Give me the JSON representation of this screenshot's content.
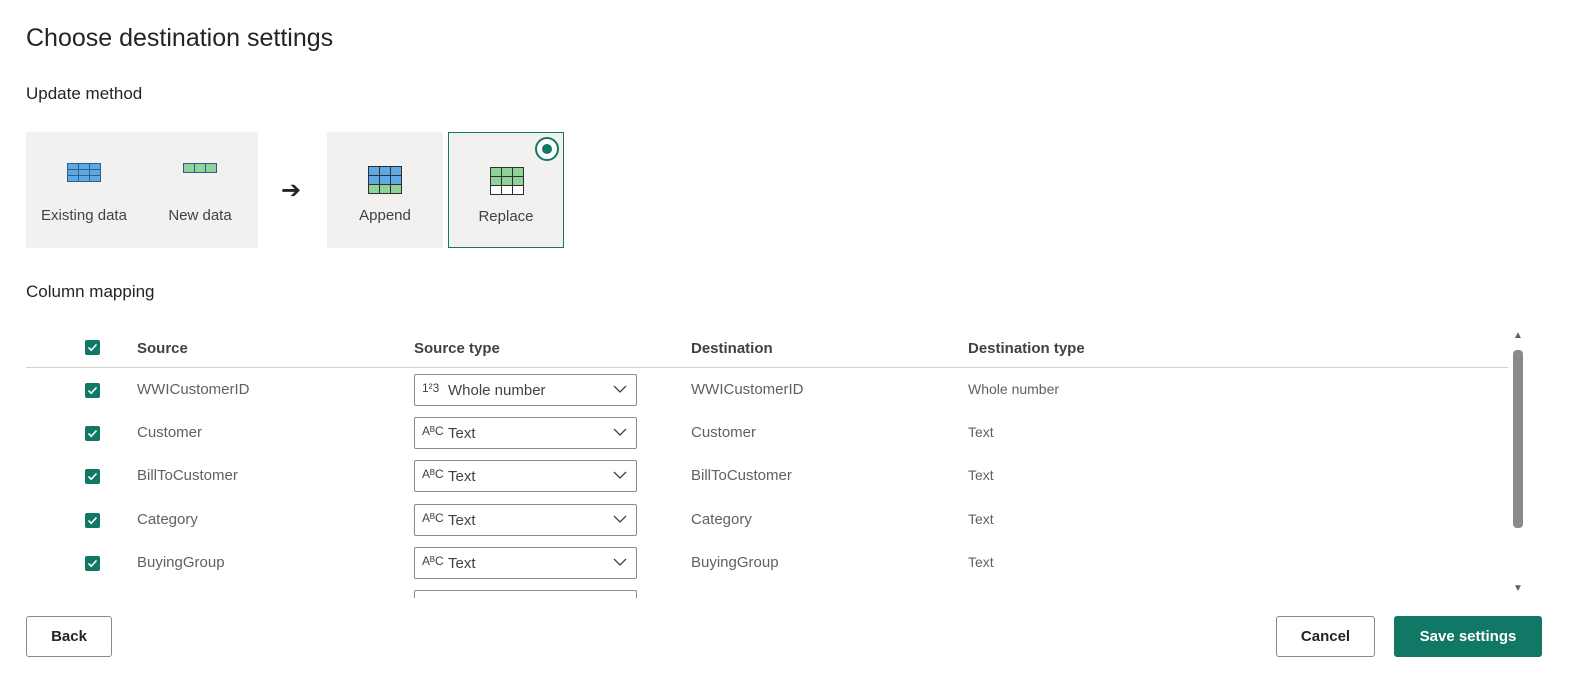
{
  "page_title": "Choose destination settings",
  "update_method": {
    "label": "Update method",
    "existing_data_label": "Existing data",
    "new_data_label": "New data",
    "append_label": "Append",
    "replace_label": "Replace",
    "selected": "Replace"
  },
  "column_mapping": {
    "label": "Column mapping",
    "headers": {
      "source": "Source",
      "source_type": "Source type",
      "destination": "Destination",
      "destination_type": "Destination type"
    },
    "rows": [
      {
        "source": "WWICustomerID",
        "source_type": "Whole number",
        "source_type_icon": "1²3",
        "destination": "WWICustomerID",
        "destination_type": "Whole number",
        "checked": true
      },
      {
        "source": "Customer",
        "source_type": "Text",
        "source_type_icon": "AᴮC",
        "destination": "Customer",
        "destination_type": "Text",
        "checked": true
      },
      {
        "source": "BillToCustomer",
        "source_type": "Text",
        "source_type_icon": "AᴮC",
        "destination": "BillToCustomer",
        "destination_type": "Text",
        "checked": true
      },
      {
        "source": "Category",
        "source_type": "Text",
        "source_type_icon": "AᴮC",
        "destination": "Category",
        "destination_type": "Text",
        "checked": true
      },
      {
        "source": "BuyingGroup",
        "source_type": "Text",
        "source_type_icon": "AᴮC",
        "destination": "BuyingGroup",
        "destination_type": "Text",
        "checked": true
      }
    ]
  },
  "buttons": {
    "back": "Back",
    "cancel": "Cancel",
    "save": "Save settings"
  },
  "colors": {
    "accent": "#117865",
    "tile_bg": "#f2f1f0"
  }
}
